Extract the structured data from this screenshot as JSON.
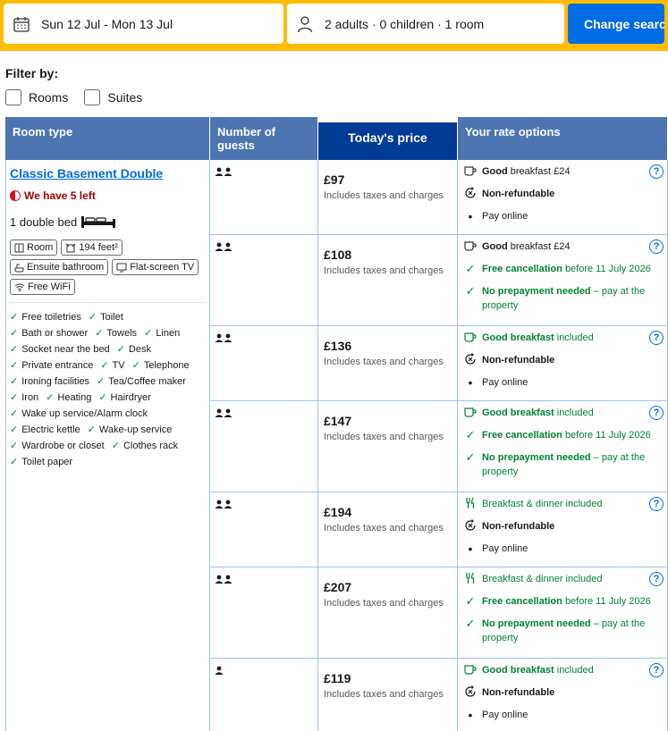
{
  "search": {
    "dates": "Sun 12 Jul - Mon 13 Jul",
    "occupancy": "2 adults · 0 children · 1 room",
    "button": "Change search"
  },
  "filter": {
    "title": "Filter by:",
    "options": [
      "Rooms",
      "Suites"
    ]
  },
  "table": {
    "headers": [
      "Room type",
      "Number of guests",
      "Today's price",
      "Your rate options"
    ]
  },
  "room": {
    "name": "Classic Basement Double",
    "availability": "We have 5 left",
    "bed": "1 double bed",
    "tags": [
      "Room",
      "194 feet²",
      "Ensuite bathroom",
      "Flat-screen TV",
      "Free WiFi"
    ],
    "facilities": [
      "Free toiletries",
      "Toilet",
      "Bath or shower",
      "Towels",
      "Linen",
      "Socket near the bed",
      "Desk",
      "Private entrance",
      "TV",
      "Telephone",
      "Ironing facilities",
      "Tea/Coffee maker",
      "Iron",
      "Heating",
      "Hairdryer",
      "Wake up service/Alarm clock",
      "Electric kettle",
      "Wake-up service",
      "Wardrobe or closet",
      "Clothes rack",
      "Toilet paper"
    ]
  },
  "rates": [
    {
      "guests": 2,
      "price": "£97",
      "taxes": "Includes taxes and charges",
      "meal_bold": "Good",
      "meal_rest": "breakfast £24",
      "lines": [
        [
          "Non-refundable",
          ""
        ],
        [
          "Pay online",
          ""
        ]
      ]
    },
    {
      "guests": 2,
      "price": "£108",
      "taxes": "Includes taxes and charges",
      "meal_bold": "Good",
      "meal_rest": "breakfast £24",
      "lines": [
        [
          "Free cancellation",
          "before 11 July 2026"
        ],
        [
          "No prepayment needed",
          "– pay at the property"
        ]
      ]
    },
    {
      "guests": 2,
      "price": "£136",
      "taxes": "Includes taxes and charges",
      "meal_bold": "Good breakfast",
      "meal_rest": "included",
      "lines": [
        [
          "Non-refundable",
          ""
        ],
        [
          "Pay online",
          ""
        ]
      ]
    },
    {
      "guests": 2,
      "price": "£147",
      "taxes": "Includes taxes and charges",
      "meal_bold": "Good breakfast",
      "meal_rest": "included",
      "lines": [
        [
          "Free cancellation",
          "before 11 July 2026"
        ],
        [
          "No prepayment needed",
          "– pay at the property"
        ]
      ]
    },
    {
      "guests": 2,
      "price": "£194",
      "taxes": "Includes taxes and charges",
      "meal_bold": "",
      "meal_rest": "Breakfast & dinner included",
      "lines": [
        [
          "Non-refundable",
          ""
        ],
        [
          "Pay online",
          ""
        ]
      ]
    },
    {
      "guests": 2,
      "price": "£207",
      "taxes": "Includes taxes and charges",
      "meal_bold": "",
      "meal_rest": "Breakfast & dinner included",
      "lines": [
        [
          "Free cancellation",
          "before 11 July 2026"
        ],
        [
          "No prepayment needed",
          "– pay at the property"
        ]
      ]
    },
    {
      "guests": 1,
      "price": "£119",
      "taxes": "Includes taxes and charges",
      "meal_bold": "Good breakfast",
      "meal_rest": "included",
      "lines": [
        [
          "Non-refundable",
          ""
        ],
        [
          "Pay online",
          ""
        ]
      ]
    }
  ],
  "colors": {
    "brand_blue": "#006ce4",
    "header_blue": "#4c76b2",
    "price_header": "#003b95",
    "search_yellow": "#febb02",
    "green": "#008234"
  }
}
